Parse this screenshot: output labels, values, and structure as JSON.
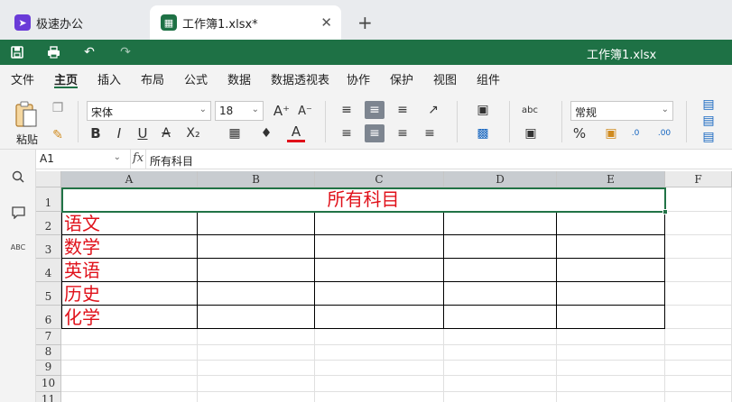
{
  "tabs": [
    {
      "label": "极速办公",
      "icon": "rocket-icon",
      "active": false
    },
    {
      "label": "工作簿1.xlsx*",
      "icon": "spreadsheet-icon",
      "active": true
    }
  ],
  "new_tab_icon": "plus-icon",
  "title_bar": {
    "document_title": "工作簿1.xlsx",
    "quick_access": [
      "save-icon",
      "print-icon",
      "undo-icon",
      "redo-icon"
    ]
  },
  "menu": [
    {
      "label": "文件"
    },
    {
      "label": "主页",
      "active": true
    },
    {
      "label": "插入"
    },
    {
      "label": "布局"
    },
    {
      "label": "公式"
    },
    {
      "label": "数据"
    },
    {
      "label": "数据透视表"
    },
    {
      "label": "协作"
    },
    {
      "label": "保护"
    },
    {
      "label": "视图"
    },
    {
      "label": "组件"
    }
  ],
  "ribbon": {
    "paste_label": "粘贴",
    "font_name": "宋体",
    "font_size": "18",
    "number_format": "常规",
    "bold": "B",
    "italic": "I",
    "underline": "U",
    "strikethrough": "A",
    "subscript": "X₂",
    "font_color": "A",
    "increase_font": "A⁺",
    "decrease_font": "A⁻",
    "percent": "%"
  },
  "formula_bar": {
    "name_box": "A1",
    "fx_label": "fx",
    "content": "所有科目"
  },
  "sheet": {
    "columns": [
      "A",
      "B",
      "C",
      "D",
      "E",
      "F"
    ],
    "selected_columns": [
      "A",
      "B",
      "C",
      "D",
      "E"
    ],
    "rows": [
      "1",
      "2",
      "3",
      "4",
      "5",
      "6",
      "7",
      "8",
      "9",
      "10",
      "11"
    ],
    "merged_title": "所有科目",
    "subjects": [
      "语文",
      "数学",
      "英语",
      "历史",
      "化学"
    ]
  },
  "colors": {
    "brand_green": "#1e7145",
    "text_red": "#e0111a",
    "selection_border": "#217346"
  }
}
